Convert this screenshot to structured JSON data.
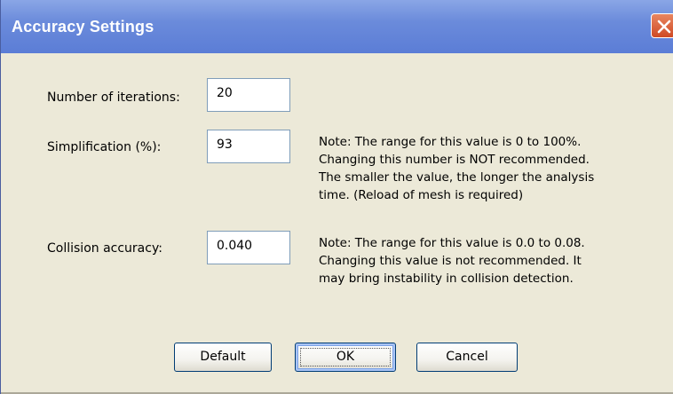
{
  "window": {
    "title": "Accuracy Settings"
  },
  "fields": {
    "iterations": {
      "label": "Number of iterations:",
      "value": "20"
    },
    "simplification": {
      "label": "Simplification (%):",
      "value": "93"
    },
    "collision": {
      "label": "Collision accuracy:",
      "value": "0.040"
    }
  },
  "notes": {
    "simplification": [
      "Note: The range for this value is 0 to 100%.",
      "Changing this number is NOT recommended.",
      "The smaller the value, the longer the analysis",
      "time. (Reload of mesh is required)"
    ],
    "collision": [
      "Note: The range for this value is 0.0 to 0.08.",
      "Changing this value is not recommended. It",
      "may bring instability in collision detection."
    ]
  },
  "buttons": {
    "default_label": "Default",
    "ok_label": "OK",
    "cancel_label": "Cancel"
  },
  "icons": {
    "close": "close-icon"
  },
  "colors": {
    "titlebar": "#5b7dd6",
    "close_button": "#d9552f",
    "dialog_background": "#ece9d8",
    "field_border": "#7f9db9"
  }
}
